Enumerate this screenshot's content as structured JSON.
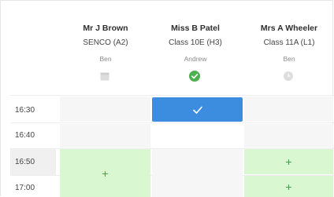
{
  "teachers": [
    {
      "name": "Mr J Brown",
      "class": "SENCO (A2)",
      "student": "Ben",
      "status_icon": "calendar-icon"
    },
    {
      "name": "Miss B Patel",
      "class": "Class 10E (H3)",
      "student": "Andrew",
      "status_icon": "check-circle-icon"
    },
    {
      "name": "Mrs A Wheeler",
      "class": "Class 11A (L1)",
      "student": "Ben",
      "status_icon": "clock-icon"
    }
  ],
  "times": [
    "16:30",
    "16:40",
    "16:50",
    "17:00"
  ],
  "slots": {
    "brown_1650": "+",
    "wheeler_1650": "+",
    "wheeler_1700": "+"
  },
  "colors": {
    "available": "#d9f7d0",
    "booked": "#3c8ce0",
    "accent_green": "#3fa341"
  }
}
